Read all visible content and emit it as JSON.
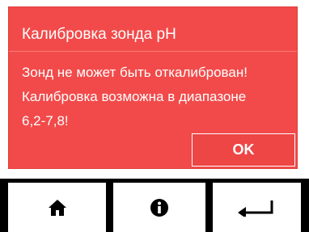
{
  "dialog": {
    "title": "Калибровка зонда pH",
    "message_lines": [
      "Зонд не может быть откалиброван!",
      "Калибровка возможна в диапазоне",
      "6,2-7,8!"
    ],
    "ok_label": "OK",
    "background_color": "#f24a4a",
    "text_color": "#ffffff"
  },
  "bottom_bar": {
    "buttons": [
      {
        "icon": "home-icon"
      },
      {
        "icon": "info-icon"
      },
      {
        "icon": "back-arrow-icon"
      }
    ],
    "bar_color": "#000000",
    "button_color": "#ffffff"
  }
}
